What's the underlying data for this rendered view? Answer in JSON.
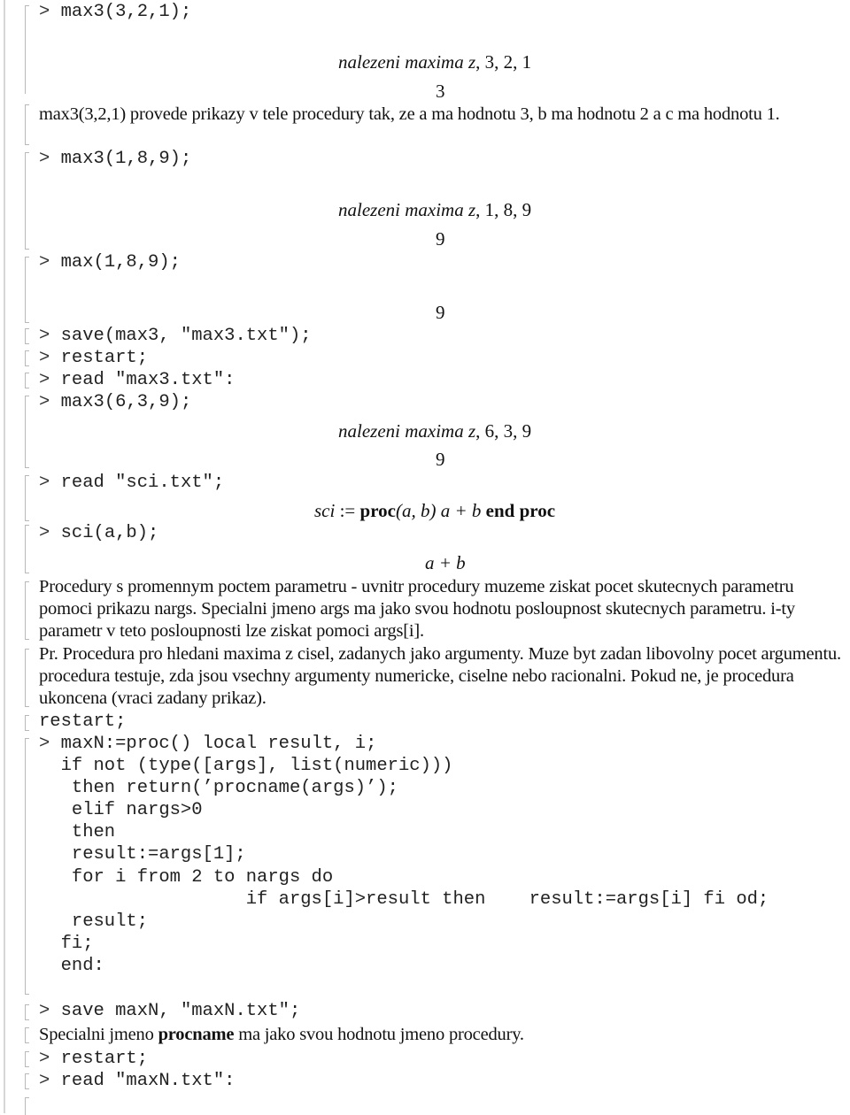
{
  "worksheet": {
    "prompt_symbol": ">",
    "blocks": {
      "max3_321": {
        "input": "max3(3,2,1);",
        "output_print": {
          "label": "nalezeni maxima z",
          "args": ", 3, 2, 1"
        },
        "output_result": "3",
        "comment": "max3(3,2,1) provede prikazy v tele procedury tak, ze a ma hodnotu 3, b ma hodnotu 2 a c ma hodnotu 1."
      },
      "max3_189": {
        "input": "max3(1,8,9);",
        "output_print": {
          "label": "nalezeni maxima z",
          "args": ", 1, 8, 9"
        },
        "output_result": "9"
      },
      "max_189": {
        "input": "max(1,8,9);",
        "output_result": "9"
      },
      "save_max3": {
        "input": "save(max3, \"max3.txt\");"
      },
      "restart_1": {
        "input": "restart;"
      },
      "read_max3": {
        "input": "read \"max3.txt\":"
      },
      "max3_639": {
        "input": "max3(6,3,9);",
        "output_print": {
          "label": "nalezeni maxima z",
          "args": ", 6, 3, 9"
        },
        "output_result": "9"
      },
      "read_sci": {
        "input": "read \"sci.txt\";",
        "output": {
          "lhs": "sci",
          "assign": " := ",
          "kw_proc": "proc",
          "params": "(a, b)",
          "body": " a + b ",
          "kw_end": "end proc"
        }
      },
      "sci_ab": {
        "input": "sci(a,b);",
        "output_result": "a + b"
      },
      "text_nargs": "Procedury s promennym poctem parametru - uvnitr procedury muzeme ziskat pocet skutecnych parametru pomoci prikazu nargs. Specialni jmeno args ma jako svou hodnotu posloupnost skutecnych parametru. i-ty parametr v teto posloupnosti lze ziskat pomoci args[i].",
      "text_example": "Pr. Procedura pro hledani maxima z cisel, zadanych jako argumenty. Muze byt zadan libovolny pocet argumentu. procedura testuje, zda jsou vsechny argumenty numericke, ciselne nebo racionalni. Pokud ne, je procedura ukoncena (vraci zadany prikaz).",
      "restart_text": "restart;",
      "maxN_def": {
        "lines": [
          "maxN:=proc() local result, i;",
          "  if not (type([args], list(numeric)))",
          "   then return(’procname(args)’);",
          "   elif nargs>0",
          "   then",
          "   result:=args[1];",
          "   for i from 2 to nargs do",
          "                   if args[i]>result then    result:=args[i] fi od;",
          "   result;",
          "  fi;",
          "  end:"
        ]
      },
      "save_maxN": {
        "input": "save maxN, \"maxN.txt\";"
      },
      "text_procname": {
        "before": "Specialni jmeno ",
        "bold": "procname",
        "after": " ma jako svou hodnotu jmeno procedury."
      },
      "restart_2": {
        "input": "restart;"
      },
      "read_maxN": {
        "input": "read \"maxN.txt\":"
      }
    }
  }
}
